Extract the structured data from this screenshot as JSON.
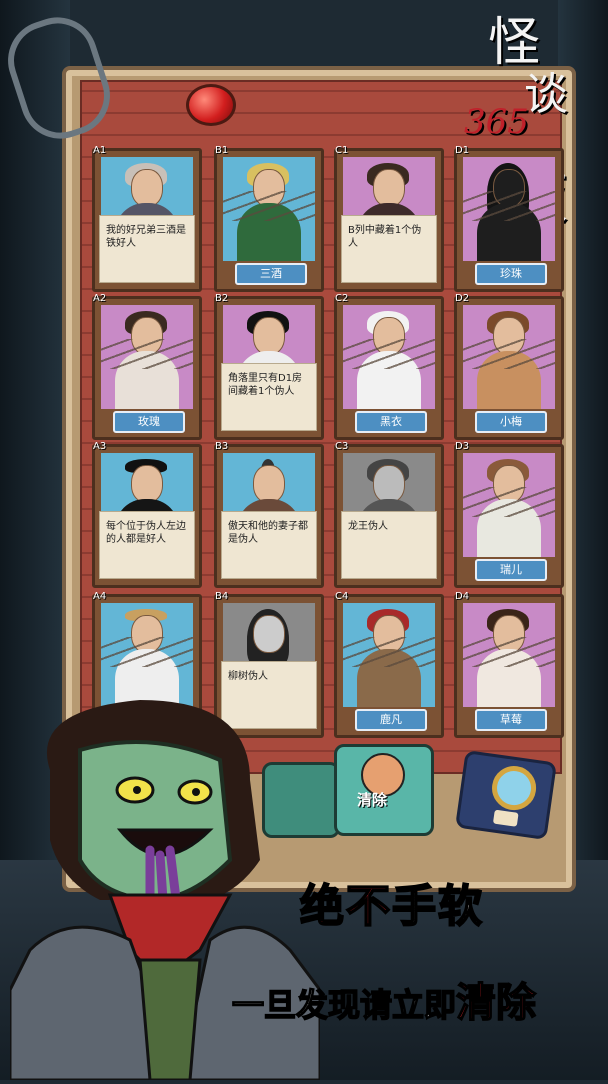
{
  "logo": {
    "line1": "怪",
    "line2": "谈",
    "number": "365",
    "line3": "夜"
  },
  "cards": [
    {
      "id": "A1",
      "name": "",
      "note": "我的好兄弟三酒是铁好人",
      "bg": "blue"
    },
    {
      "id": "B1",
      "name": "三酒",
      "note": "",
      "bg": "blue"
    },
    {
      "id": "C1",
      "name": "",
      "note": "B列中藏着1个伪人",
      "bg": "pink"
    },
    {
      "id": "D1",
      "name": "珍珠",
      "note": "",
      "bg": "pink"
    },
    {
      "id": "A2",
      "name": "玫瑰",
      "note": "",
      "bg": "pink"
    },
    {
      "id": "B2",
      "name": "",
      "note": "角落里只有D1房间藏着1个伪人",
      "bg": "pink"
    },
    {
      "id": "C2",
      "name": "黑衣",
      "note": "",
      "bg": "pink"
    },
    {
      "id": "D2",
      "name": "小梅",
      "note": "",
      "bg": "pink"
    },
    {
      "id": "A3",
      "name": "",
      "note": "每个位于伪人左边的人都是好人",
      "bg": "blue"
    },
    {
      "id": "B3",
      "name": "",
      "note": "傲天和他的妻子都是伪人",
      "bg": "blue"
    },
    {
      "id": "C3",
      "name": "",
      "note": "龙王伪人",
      "bg": "gray"
    },
    {
      "id": "D3",
      "name": "瑞儿",
      "note": "",
      "bg": "pink"
    },
    {
      "id": "A4",
      "name": "",
      "note": "",
      "bg": "blue"
    },
    {
      "id": "B4",
      "name": "",
      "note": "柳树伪人",
      "bg": "gray"
    },
    {
      "id": "C4",
      "name": "鹿凡",
      "note": "",
      "bg": "blue"
    },
    {
      "id": "D4",
      "name": "草莓",
      "note": "",
      "bg": "pink"
    }
  ],
  "tools": {
    "clear_label": "清除"
  },
  "promo": {
    "line1_part1": "绝不",
    "line1_part2": "手软",
    "line2_part1": "一旦发现请立即",
    "line2_part2": "清除"
  },
  "colors": {
    "accent_red": "#e5262a",
    "name_tag": "#4d8fc2",
    "wall": "#a94a3d"
  }
}
